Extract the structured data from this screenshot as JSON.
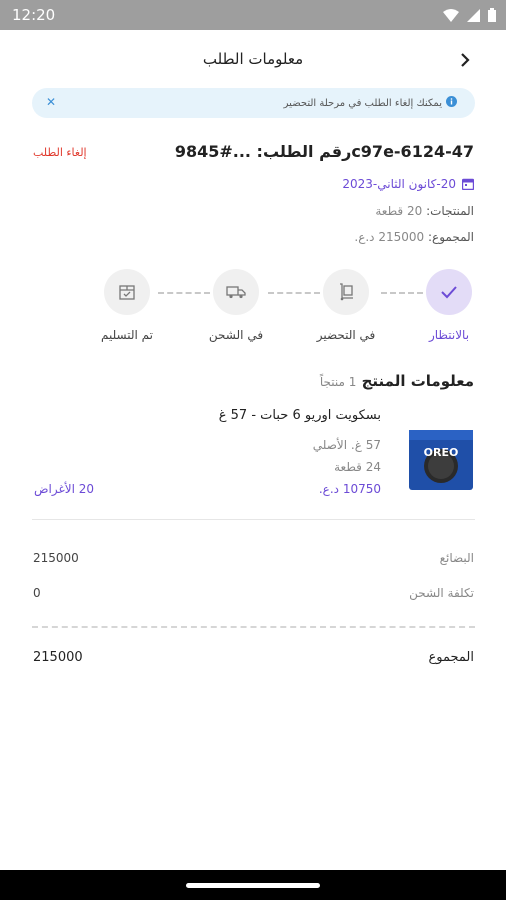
{
  "status_bar": {
    "time": "12:20"
  },
  "header": {
    "title": "معلومات الطلب"
  },
  "notice": {
    "message": "يمكنك إلغاء الطلب في مرحلة التحضير"
  },
  "order": {
    "number": "رقم الطلب: ...#9845c97e-6124-47",
    "cancel_label": "إلغاء الطلب",
    "date": "20-كانون الثاني-2023",
    "products_label": "المنتجات:",
    "products_value": "20 قطعة",
    "total_label": "المجموع:",
    "total_value": "215000 د.ع."
  },
  "steps": [
    {
      "label": "بالانتظار",
      "state": "active"
    },
    {
      "label": "في التحضير",
      "state": "pending"
    },
    {
      "label": "في الشحن",
      "state": "pending"
    },
    {
      "label": "تم التسليم",
      "state": "pending"
    }
  ],
  "products_section": {
    "title": "معلومات المنتج",
    "count": "1 منتجاً"
  },
  "product": {
    "name": "بسكويت اوريو 6 حبات - 57 غ",
    "original": "57 غ. الأصلي",
    "qty": "24 قطعة",
    "price": "10750 د.ع.",
    "items": "20 الأغراض",
    "image_brand": "OREO"
  },
  "summary": {
    "goods_label": "البضائع",
    "goods_value": "215000",
    "shipping_label": "تكلفة الشحن",
    "shipping_value": "0",
    "total_label": "المجموع",
    "total_value": "215000"
  },
  "colors": {
    "accent": "#6c4bd6",
    "danger": "#e0392d",
    "info_bg": "#e6f3fb"
  }
}
